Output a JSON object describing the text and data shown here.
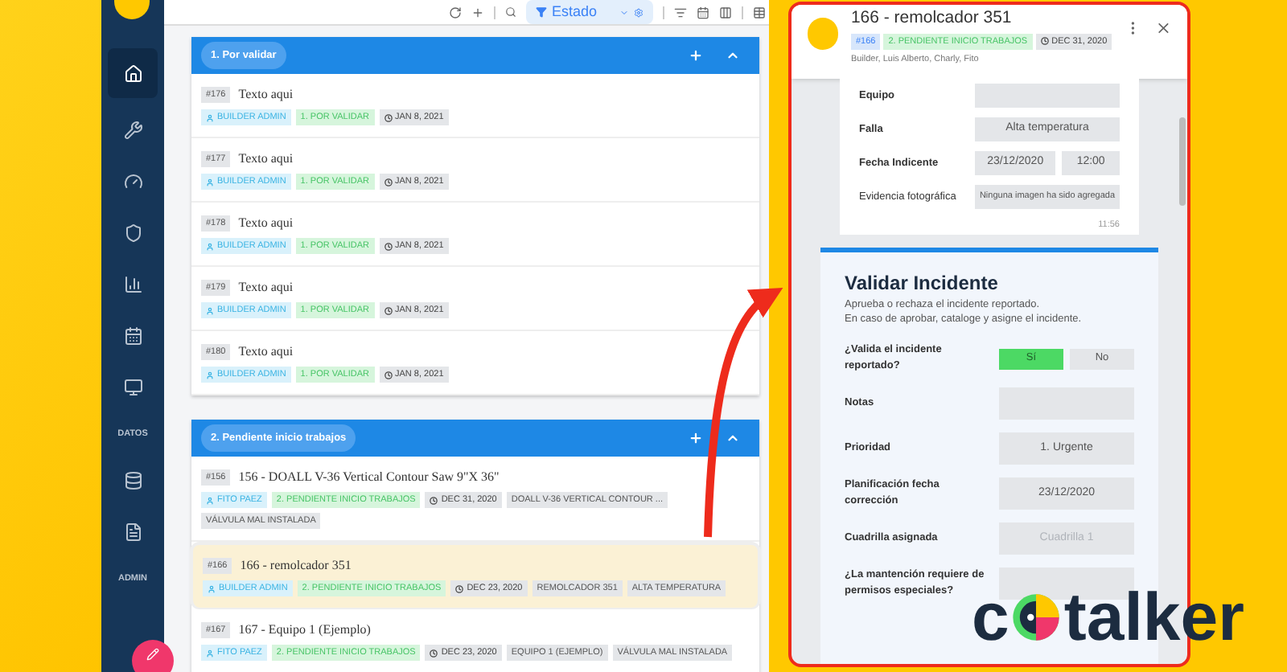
{
  "sidebar": {
    "items": [
      {
        "kind": "home",
        "selected": true
      },
      {
        "kind": "wrench",
        "selected": false
      },
      {
        "kind": "gauge",
        "selected": false
      },
      {
        "kind": "shield",
        "selected": false
      },
      {
        "kind": "chart",
        "selected": false
      },
      {
        "kind": "calendar",
        "selected": false
      },
      {
        "kind": "monitor",
        "selected": false
      },
      {
        "kind": "label",
        "text": "DATOS"
      },
      {
        "kind": "database",
        "selected": false
      },
      {
        "kind": "document",
        "selected": false
      },
      {
        "kind": "label",
        "text": "ADMIN"
      }
    ]
  },
  "toolbar": {
    "filter": "Estado"
  },
  "groups": [
    {
      "title": "1. Por validar",
      "items": [
        {
          "id": "#176",
          "title": "Texto aqui",
          "selected": false,
          "tags": [
            {
              "kind": "user",
              "text": "BUILDER ADMIN"
            },
            {
              "kind": "state",
              "text": "1. POR VALIDAR"
            },
            {
              "kind": "date",
              "text": "JAN 8, 2021"
            }
          ]
        },
        {
          "id": "#177",
          "title": "Texto aqui",
          "selected": false,
          "tags": [
            {
              "kind": "user",
              "text": "BUILDER ADMIN"
            },
            {
              "kind": "state",
              "text": "1. POR VALIDAR"
            },
            {
              "kind": "date",
              "text": "JAN 8, 2021"
            }
          ]
        },
        {
          "id": "#178",
          "title": "Texto aqui",
          "selected": false,
          "tags": [
            {
              "kind": "user",
              "text": "BUILDER ADMIN"
            },
            {
              "kind": "state",
              "text": "1. POR VALIDAR"
            },
            {
              "kind": "date",
              "text": "JAN 8, 2021"
            }
          ]
        },
        {
          "id": "#179",
          "title": "Texto aqui",
          "selected": false,
          "tags": [
            {
              "kind": "user",
              "text": "BUILDER ADMIN"
            },
            {
              "kind": "state",
              "text": "1. POR VALIDAR"
            },
            {
              "kind": "date",
              "text": "JAN 8, 2021"
            }
          ]
        },
        {
          "id": "#180",
          "title": "Texto aqui",
          "selected": false,
          "tags": [
            {
              "kind": "user",
              "text": "BUILDER ADMIN"
            },
            {
              "kind": "state",
              "text": "1. POR VALIDAR"
            },
            {
              "kind": "date",
              "text": "JAN 8, 2021"
            }
          ]
        }
      ]
    },
    {
      "title": "2. Pendiente inicio trabajos",
      "items": [
        {
          "id": "#156",
          "title": "156 - DOALL V-36 Vertical Contour Saw 9\"X 36\"",
          "selected": false,
          "tags": [
            {
              "kind": "user",
              "text": "FITO PAEZ"
            },
            {
              "kind": "state",
              "text": "2. PENDIENTE INICIO TRABAJOS"
            },
            {
              "kind": "date",
              "text": "DEC 31, 2020"
            },
            {
              "kind": "plain",
              "text": "DOALL V-36 VERTICAL CONTOUR ..."
            },
            {
              "kind": "plain",
              "text": "VÁLVULA MAL INSTALADA"
            }
          ]
        },
        {
          "id": "#166",
          "title": "166 - remolcador 351",
          "selected": true,
          "tags": [
            {
              "kind": "user",
              "text": "BUILDER ADMIN"
            },
            {
              "kind": "state",
              "text": "2. PENDIENTE INICIO TRABAJOS"
            },
            {
              "kind": "date",
              "text": "DEC 23, 2020"
            },
            {
              "kind": "plain",
              "text": "REMOLCADOR 351"
            },
            {
              "kind": "plain",
              "text": "ALTA TEMPERATURA"
            }
          ]
        },
        {
          "id": "#167",
          "title": "167 - Equipo 1 (Ejemplo)",
          "selected": false,
          "tags": [
            {
              "kind": "user",
              "text": "FITO PAEZ"
            },
            {
              "kind": "state",
              "text": "2. PENDIENTE INICIO TRABAJOS"
            },
            {
              "kind": "date",
              "text": "DEC 23, 2020"
            },
            {
              "kind": "plain",
              "text": "EQUIPO 1 (EJEMPLO)"
            },
            {
              "kind": "plain",
              "text": "VÁLVULA MAL INSTALADA"
            }
          ]
        }
      ]
    }
  ],
  "panel": {
    "title": "166 - remolcador 351",
    "tags": [
      {
        "kind": "id",
        "text": "#166"
      },
      {
        "kind": "state",
        "text": "2. PENDIENTE INICIO TRABAJOS"
      },
      {
        "kind": "date",
        "text": "DEC 31, 2020"
      }
    ],
    "members": "Builder, Luis Alberto, Charly, Fito",
    "report": {
      "rows": [
        {
          "label": "Equipo",
          "values": []
        },
        {
          "label": "Falla",
          "values": [
            "Alta temperatura"
          ]
        },
        {
          "label": "Fecha Indicente",
          "values": [
            "23/12/2020",
            "12:00"
          ]
        },
        {
          "label": "Evidencia fotográfica",
          "values": [
            "Ninguna imagen ha sido agregada"
          ]
        }
      ],
      "time": "11:56"
    },
    "validate": {
      "title": "Validar Incidente",
      "description": [
        "Aprueba o rechaza el incidente reportado.",
        "En caso de aprobar, cataloge y asigne el incidente."
      ],
      "rows": [
        {
          "kind": "choice",
          "label": "¿Valida el incidente reportado?",
          "options": [
            {
              "label": "Sí",
              "selected": true
            },
            {
              "label": "No",
              "selected": false
            }
          ]
        },
        {
          "kind": "field",
          "label": "Notas"
        },
        {
          "kind": "field",
          "label": "Prioridad",
          "value": "1. Urgente"
        },
        {
          "kind": "field",
          "label": "Planificación fecha corrección",
          "value": "23/12/2020"
        },
        {
          "kind": "field",
          "label": "Cuadrilla asignada",
          "placeholder": "Cuadrilla 1"
        },
        {
          "kind": "field",
          "label": "¿La mantención requiere de permisos especiales?"
        }
      ]
    }
  },
  "logo": {
    "start": "c",
    "end": "talker"
  }
}
